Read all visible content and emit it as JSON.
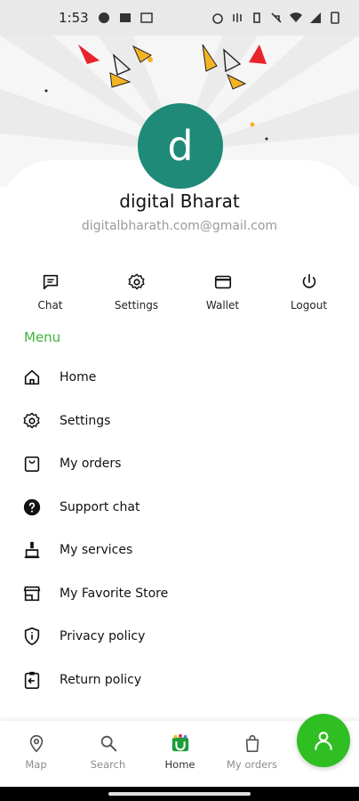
{
  "status_bar": {
    "time": "1:53"
  },
  "profile": {
    "avatar_letter": "d",
    "name": "digital Bharat",
    "email": "digitalbharath.com@gmail.com"
  },
  "quick_actions": [
    {
      "label": "Chat",
      "icon": "chat-icon"
    },
    {
      "label": "Settings",
      "icon": "gear-icon"
    },
    {
      "label": "Wallet",
      "icon": "wallet-icon"
    },
    {
      "label": "Logout",
      "icon": "power-icon"
    }
  ],
  "menu": {
    "heading": "Menu",
    "items": [
      {
        "label": "Home",
        "icon": "home-icon"
      },
      {
        "label": "Settings",
        "icon": "gear-icon"
      },
      {
        "label": "My orders",
        "icon": "shopping-bag-icon"
      },
      {
        "label": "Support chat",
        "icon": "help-circle-icon"
      },
      {
        "label": "My services",
        "icon": "cleaning-brush-icon"
      },
      {
        "label": "My Favorite Store",
        "icon": "store-icon"
      },
      {
        "label": "Privacy policy",
        "icon": "shield-info-icon"
      },
      {
        "label": "Return policy",
        "icon": "return-clipboard-icon"
      }
    ]
  },
  "bottom_nav": [
    {
      "label": "Map",
      "icon": "map-pin-icon"
    },
    {
      "label": "Search",
      "icon": "search-icon"
    },
    {
      "label": "Home",
      "icon": "app-logo-icon"
    },
    {
      "label": "My orders",
      "icon": "shopping-bag-icon"
    }
  ],
  "colors": {
    "accent_green": "#2fbf22",
    "avatar_teal": "#1e8a77",
    "menu_heading": "#3db33d"
  }
}
